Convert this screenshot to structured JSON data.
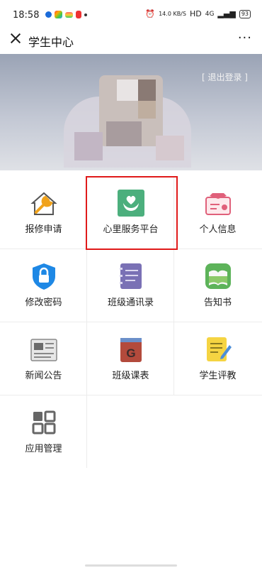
{
  "status_bar": {
    "time": "18:58",
    "network": "14.0 KB/S",
    "hd": "HD",
    "signal": "4G",
    "battery": "93"
  },
  "header": {
    "title": "学生中心",
    "more_label": "···"
  },
  "banner": {
    "logout_label": "[ 退出登录 ]"
  },
  "menu": {
    "items": [
      {
        "label": "报修申请",
        "icon": "house-wrench-icon"
      },
      {
        "label": "心里服务平台",
        "icon": "heart-hands-icon"
      },
      {
        "label": "个人信息",
        "icon": "profile-card-icon"
      },
      {
        "label": "修改密码",
        "icon": "lock-shield-icon"
      },
      {
        "label": "班级通讯录",
        "icon": "contact-list-icon"
      },
      {
        "label": "告知书",
        "icon": "notice-book-icon"
      },
      {
        "label": "新闻公告",
        "icon": "newspaper-icon"
      },
      {
        "label": "班级课表",
        "icon": "schedule-book-icon"
      },
      {
        "label": "学生评教",
        "icon": "evaluation-note-icon"
      },
      {
        "label": "应用管理",
        "icon": "grid-apps-icon"
      }
    ]
  },
  "colors": {
    "highlight": "#e01a1a",
    "green": "#4caf7d",
    "blue": "#1e88e5"
  }
}
